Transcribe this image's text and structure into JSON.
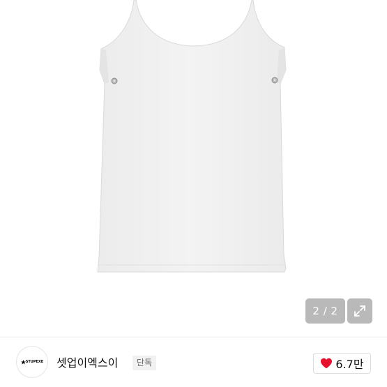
{
  "gallery": {
    "counter": "2 / 2",
    "expand_icon": "expand-arrows-icon"
  },
  "brand": {
    "logo_text": "STUPEXE",
    "name": "셋업이엑스이",
    "badge": "단독"
  },
  "like": {
    "icon": "heart-icon",
    "count": "6.7만",
    "color": "#e8112d"
  }
}
